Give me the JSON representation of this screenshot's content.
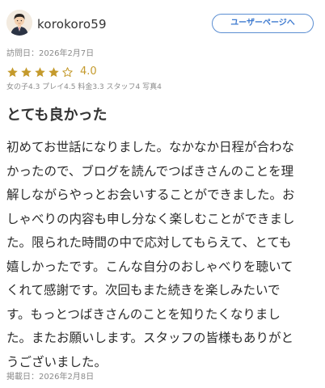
{
  "user": {
    "name": "korokoro59",
    "avatar_icon": "avatar-person-icon",
    "profile_button_label": "ユーザーページへ"
  },
  "review": {
    "visit_date": "訪問日：2026年2月7日",
    "rating": {
      "stars_filled": 4,
      "stars_total": 5,
      "value_label": "4.0",
      "star_color": "#c49a2c"
    },
    "sub_scores": "女の子4.3 プレイ4.5 料金3.3 スタッフ4 写真4",
    "title": "とても良かった",
    "body_lines": [
      "初めてお世話になりました。なかなか日程が合わな",
      "かったので、ブログを読んでつばきさんのことを理",
      "解しながらやっとお会いすることができました。お",
      "しゃべりの内容も申し分なく楽しむことができまし",
      "た。限られた時間の中で応対してもらえて、とても",
      "嬉しかったです。こんな自分のおしゃべりを聴いて",
      "くれて感謝です。次回もまた続きを楽しみたいで",
      "す。もっとつばきさんのことを知りたくなりまし",
      "た。またお願いします。スタッフの皆様もありがと",
      "うございました。"
    ],
    "posted_date": "掲載日：2026年2月8日"
  },
  "colors": {
    "button_border": "#5b8ed2",
    "button_text": "#3f7bd0",
    "muted_text": "#8a8a8a"
  }
}
